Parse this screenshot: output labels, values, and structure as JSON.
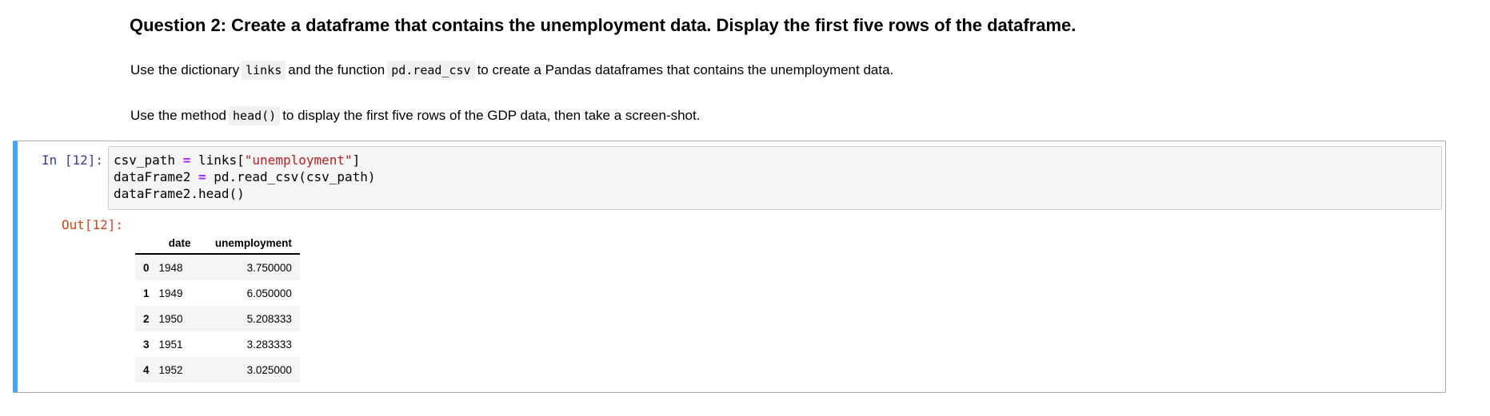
{
  "title": "Question 2: Create a dataframe that contains the unemployment data. Display the first five rows of the dataframe.",
  "para1": {
    "t1": "Use the dictionary",
    "c1": "links",
    "t2": "and the function",
    "c2": "pd.read_csv",
    "t3": "to create a Pandas dataframes that contains the unemployment data."
  },
  "para2": {
    "t1": "Use the method",
    "c1": "head()",
    "t2": "to display the first five rows of the GDP data, then take a screen-shot."
  },
  "cell": {
    "in_prompt": "In [12]:",
    "out_prompt": "Out[12]:",
    "code": {
      "l1a": "csv_path ",
      "l1op": "=",
      "l1b": " links[",
      "l1s": "\"unemployment\"",
      "l1c": "]",
      "l2a": "dataFrame2 ",
      "l2op": "=",
      "l2b": " pd.read_csv(csv_path)",
      "l3": "dataFrame2.head()"
    },
    "accent_color": "#42a5f5"
  },
  "table": {
    "columns": [
      "",
      "date",
      "unemployment"
    ],
    "rows": [
      {
        "index": "0",
        "date": "1948",
        "unemployment": "3.750000"
      },
      {
        "index": "1",
        "date": "1949",
        "unemployment": "6.050000"
      },
      {
        "index": "2",
        "date": "1950",
        "unemployment": "5.208333"
      },
      {
        "index": "3",
        "date": "1951",
        "unemployment": "3.283333"
      },
      {
        "index": "4",
        "date": "1952",
        "unemployment": "3.025000"
      }
    ]
  }
}
